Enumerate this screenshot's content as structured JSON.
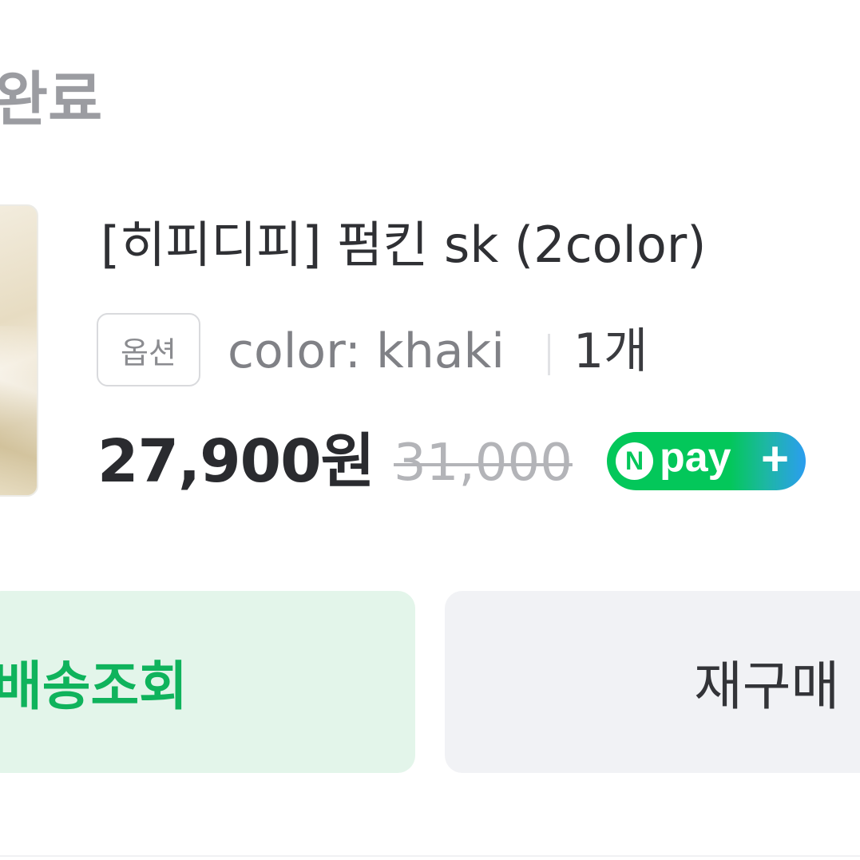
{
  "order": {
    "status_title": "완료",
    "product": {
      "name": "[히피디피] 펌킨 sk (2color)",
      "option_badge": "옵션",
      "option_value": "color: khaki",
      "quantity": "1개",
      "price": "27,900원",
      "original_price": "31,000",
      "npay_badge": {
        "n_letter": "N",
        "label": "pay",
        "plus": "+"
      }
    },
    "actions": {
      "track_label": "배송조회",
      "rebuy_label": "재구매"
    }
  },
  "colors": {
    "accent_green": "#03c75a",
    "track_button_bg": "#e3f5ea",
    "track_button_text": "#0fb35c",
    "rebuy_button_bg": "#f1f2f5"
  }
}
